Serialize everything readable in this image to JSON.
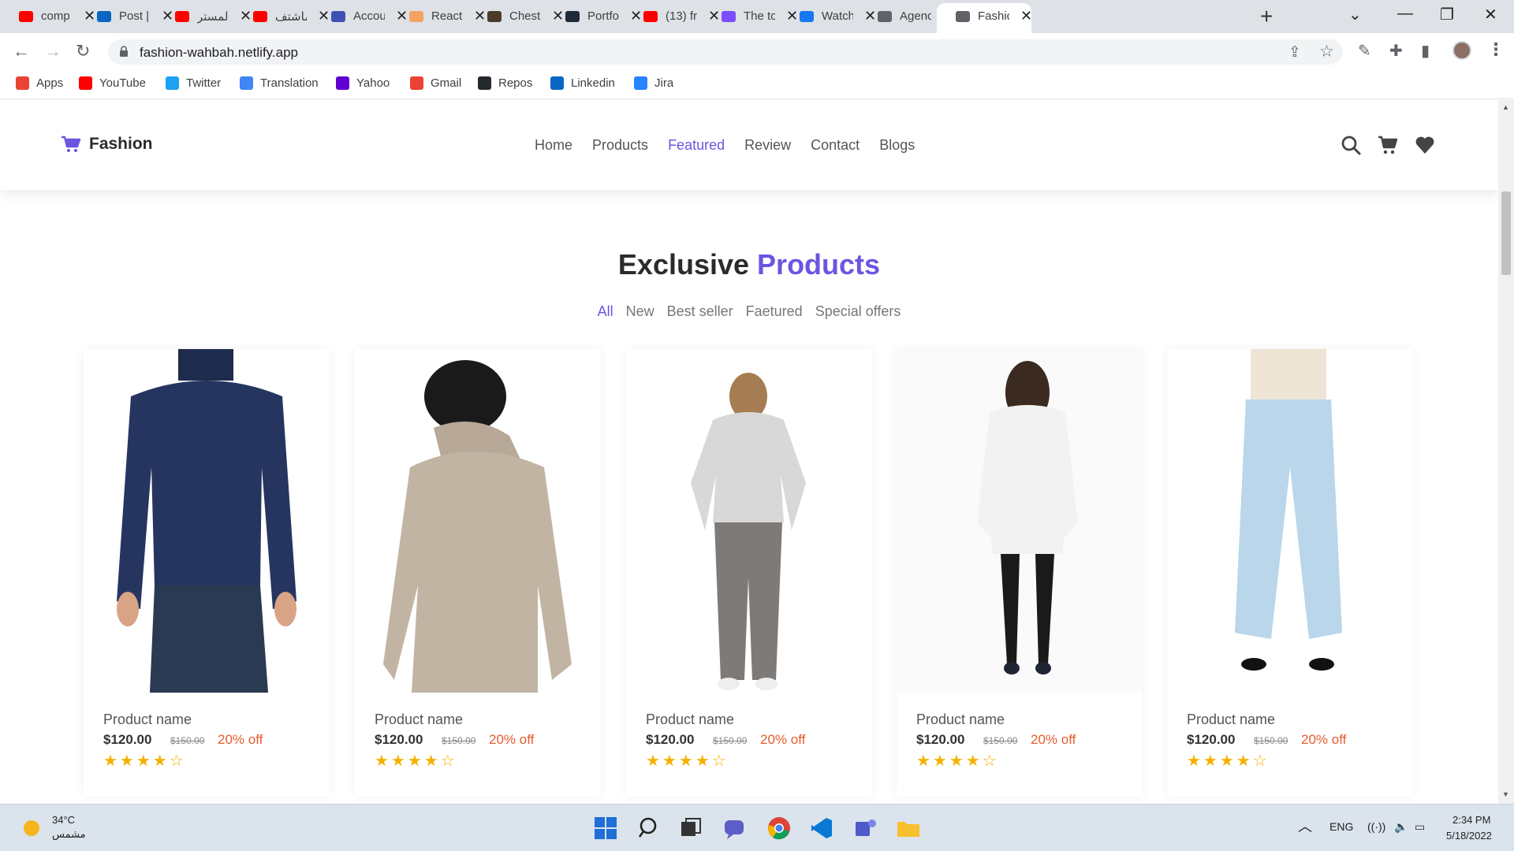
{
  "browser": {
    "tabs": [
      {
        "title": "comp",
        "color": "#ff0000"
      },
      {
        "title": "Post |",
        "color": "#0a66c2"
      },
      {
        "title": "المستر",
        "color": "#ff0000"
      },
      {
        "title": "ماشتف",
        "color": "#ff0000"
      },
      {
        "title": "Accou",
        "color": "#3f51b5"
      },
      {
        "title": "React",
        "color": "#f4a261"
      },
      {
        "title": "Chest",
        "color": "#4a3b2b"
      },
      {
        "title": "Portfo",
        "color": "#1e2a3a"
      },
      {
        "title": "(13) fr",
        "color": "#ff0000"
      },
      {
        "title": "The to",
        "color": "#7c4dff"
      },
      {
        "title": "Watch",
        "color": "#1877f2"
      },
      {
        "title": "Agenc",
        "color": "#5f6368"
      },
      {
        "title": "Fashic",
        "color": "#5f6368"
      }
    ],
    "close_glyph": "✕",
    "new_tab_glyph": "+",
    "url": "fashion-wahbah.netlify.app",
    "bookmarks": [
      {
        "label": "Apps",
        "color": "#ea4335"
      },
      {
        "label": "YouTube",
        "color": "#ff0000"
      },
      {
        "label": "Twitter",
        "color": "#1da1f2"
      },
      {
        "label": "Translation",
        "color": "#4285f4"
      },
      {
        "label": "Yahoo",
        "color": "#6001d2"
      },
      {
        "label": "Gmail",
        "color": "#ea4335"
      },
      {
        "label": "Repos",
        "color": "#24292e"
      },
      {
        "label": "Linkedin",
        "color": "#0a66c2"
      },
      {
        "label": "Jira",
        "color": "#2684ff"
      }
    ]
  },
  "site": {
    "logo_text": "Fashion",
    "nav": [
      {
        "label": "Home",
        "active": false
      },
      {
        "label": "Products",
        "active": false
      },
      {
        "label": "Featured",
        "active": true
      },
      {
        "label": "Review",
        "active": false
      },
      {
        "label": "Contact",
        "active": false
      },
      {
        "label": "Blogs",
        "active": false
      }
    ],
    "accent_color": "#6b55e0",
    "section_title": {
      "main": "Exclusive",
      "accent": "Products"
    },
    "filters": [
      {
        "label": "All",
        "active": true
      },
      {
        "label": "New",
        "active": false
      },
      {
        "label": "Best seller",
        "active": false
      },
      {
        "label": "Faetured",
        "active": false
      },
      {
        "label": "Special offers",
        "active": false
      }
    ],
    "products": [
      {
        "name": "Product name",
        "price": "$120.00",
        "old_price": "$150.00",
        "discount": "20% off",
        "stars": "★★★★☆",
        "rating": 4
      },
      {
        "name": "Product name",
        "price": "$120.00",
        "old_price": "$150.00",
        "discount": "20% off",
        "stars": "★★★★☆",
        "rating": 4
      },
      {
        "name": "Product name",
        "price": "$120.00",
        "old_price": "$150.00",
        "discount": "20% off",
        "stars": "★★★★☆",
        "rating": 4
      },
      {
        "name": "Product name",
        "price": "$120.00",
        "old_price": "$150.00",
        "discount": "20% off",
        "stars": "★★★★☆",
        "rating": 4
      },
      {
        "name": "Product name",
        "price": "$120.00",
        "old_price": "$150.00",
        "discount": "20% off",
        "stars": "★★★★☆",
        "rating": 4
      }
    ]
  },
  "taskbar": {
    "temperature": "34°C",
    "weather_desc": "مشمس",
    "language": "ENG",
    "time": "2:34 PM",
    "date": "5/18/2022"
  }
}
